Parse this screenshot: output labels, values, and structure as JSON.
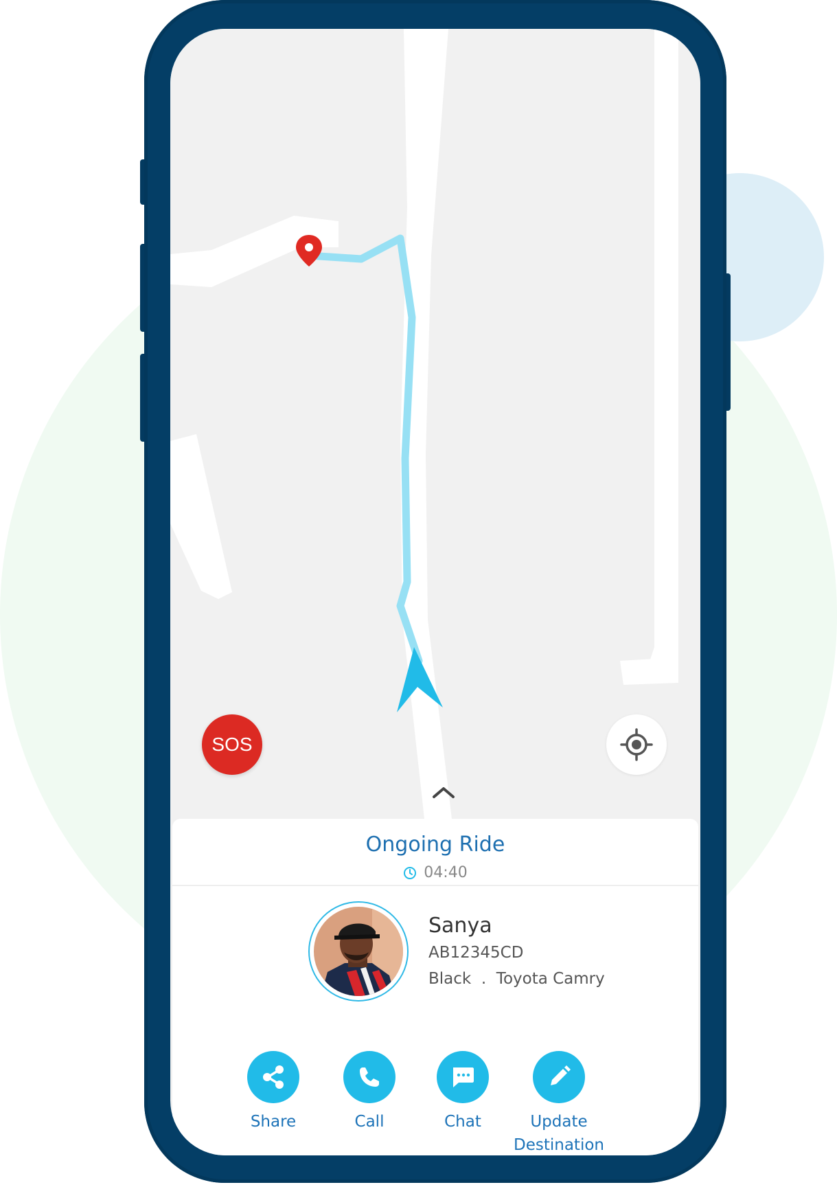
{
  "map": {
    "sos_label": "SOS",
    "route_color": "#97e0f4",
    "marker_color": "#e02a23",
    "arrow_color": "#21bbe8"
  },
  "ride": {
    "title": "Ongoing Ride",
    "timer": "04:40"
  },
  "driver": {
    "name": "Sanya",
    "plate": "AB12345CD",
    "color": "Black",
    "separator": ".",
    "model": "Toyota Camry"
  },
  "actions": [
    {
      "label": "Share",
      "icon": "share-icon"
    },
    {
      "label": "Call",
      "icon": "phone-icon"
    },
    {
      "label": "Chat",
      "icon": "chat-icon"
    },
    {
      "label": "Update Destination",
      "icon": "pencil-icon"
    }
  ],
  "colors": {
    "phone_frame": "#043e66",
    "accent": "#21bbe8",
    "title_blue": "#1d6fb0",
    "sos_red": "#dc2a23"
  }
}
